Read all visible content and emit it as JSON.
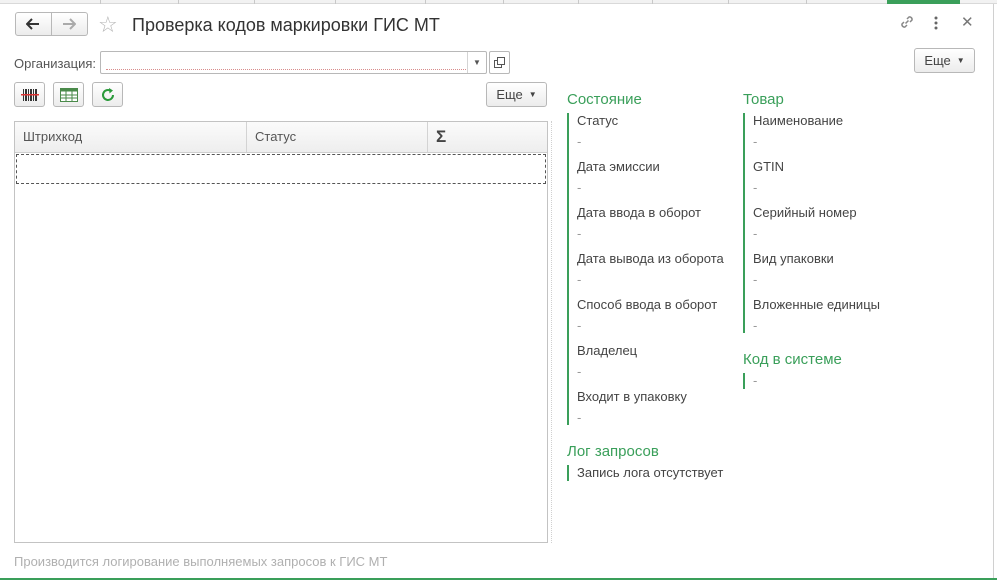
{
  "window": {
    "title": "Проверка кодов маркировки ГИС МТ",
    "nav_back_icon": "arrow-left-icon",
    "nav_forward_icon": "arrow-right-icon",
    "favorite_icon": "star-icon",
    "link_icon": "link-icon",
    "menu_icon": "kebab-menu-icon",
    "close_icon": "close-icon",
    "more_label": "Еще"
  },
  "organization": {
    "label": "Организация:",
    "value": ""
  },
  "toolbar": {
    "barcode_icon": "barcode-scan-icon",
    "table_icon": "table-load-icon",
    "refresh_icon": "refresh-icon",
    "more_label": "Еще"
  },
  "table": {
    "columns": [
      "Штрихкод",
      "Статус",
      "Σ"
    ],
    "rows": []
  },
  "sections": {
    "state": {
      "title": "Состояние",
      "fields": [
        {
          "label": "Статус",
          "value": "-"
        },
        {
          "label": "Дата эмиссии",
          "value": "-"
        },
        {
          "label": "Дата ввода в оборот",
          "value": "-"
        },
        {
          "label": "Дата вывода из оборота",
          "value": "-"
        },
        {
          "label": "Способ ввода в оборот",
          "value": "-"
        },
        {
          "label": "Владелец",
          "value": "-"
        },
        {
          "label": "Входит в упаковку",
          "value": "-"
        }
      ]
    },
    "product": {
      "title": "Товар",
      "fields": [
        {
          "label": "Наименование",
          "value": "-"
        },
        {
          "label": "GTIN",
          "value": "-"
        },
        {
          "label": "Серийный номер",
          "value": "-"
        },
        {
          "label": "Вид упаковки",
          "value": "-"
        },
        {
          "label": "Вложенные единицы",
          "value": "-"
        }
      ]
    },
    "code": {
      "title": "Код в системе",
      "value": "-"
    },
    "log": {
      "title": "Лог запросов",
      "value": "Запись лога отсутствует"
    }
  },
  "footer": {
    "note": "Производится логирование выполняемых запросов к ГИС МТ"
  },
  "colors": {
    "accent": "#3a9f5a"
  }
}
